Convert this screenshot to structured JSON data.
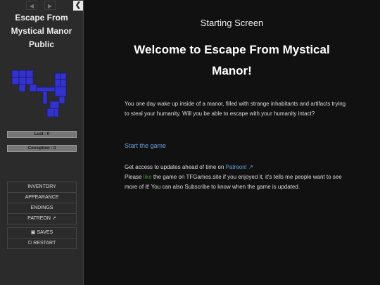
{
  "sidebar": {
    "back_arrow": "◀",
    "forward_arrow": "▶",
    "collapse_icon": "❮",
    "title": "Escape From Mystical Manor Public",
    "lust_label": "Lust : 0",
    "corruption_label": "Corruption : 0",
    "menu": [
      "INVENTORY",
      "APPEARANCE",
      "ENDINGS",
      "PATREON"
    ],
    "saves_label": "SAVES",
    "restart_label": "RESTART",
    "map_color": "#3333cc"
  },
  "main": {
    "passage_title": "Starting Screen",
    "headline": "Welcome to Escape From Mystical Manor!",
    "intro": "You one day wake up inside of a manor, filled with strange inhabitants and artifacts trying to steal your humanity. Will you be able to escape with your humanity intact?",
    "start_link": "Start the game",
    "patreon_text": "Get access to updates ahead of time on ",
    "patreon_link": "Patreon!",
    "like_before": "Please ",
    "like_word": "like",
    "like_after": " the game on TFGames.site if you enjoyed it, it's tells me people want to see more of it! You can also Subscribe to know when the game is updated."
  }
}
